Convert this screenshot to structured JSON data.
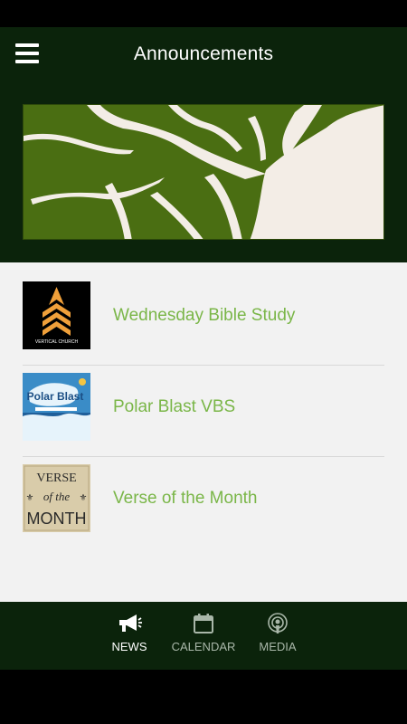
{
  "header": {
    "title": "Announcements",
    "menu_icon": "hamburger-menu-icon"
  },
  "banner": {
    "description_icon": "leaf-graphic",
    "colors": {
      "background": "#4a6e12",
      "leaf": "#f3ede6"
    }
  },
  "items": [
    {
      "label": "Wednesday Bible Study",
      "thumb_text": "VERTICAL CHURCH"
    },
    {
      "label": "Polar Blast VBS",
      "thumb_text": "Polar Blast"
    },
    {
      "label": "Verse of the Month",
      "thumb_text": {
        "line1": "VERSE",
        "line2": "of the",
        "line3": "MONTH"
      }
    }
  ],
  "tabs": [
    {
      "label": "NEWS",
      "icon": "megaphone-icon",
      "active": true
    },
    {
      "label": "CALENDAR",
      "icon": "calendar-icon",
      "active": false
    },
    {
      "label": "MEDIA",
      "icon": "podcast-icon",
      "active": false
    }
  ],
  "colors": {
    "header_bg": "#0b230b",
    "accent_green": "#7ab648",
    "list_bg": "#f2f2f2"
  }
}
